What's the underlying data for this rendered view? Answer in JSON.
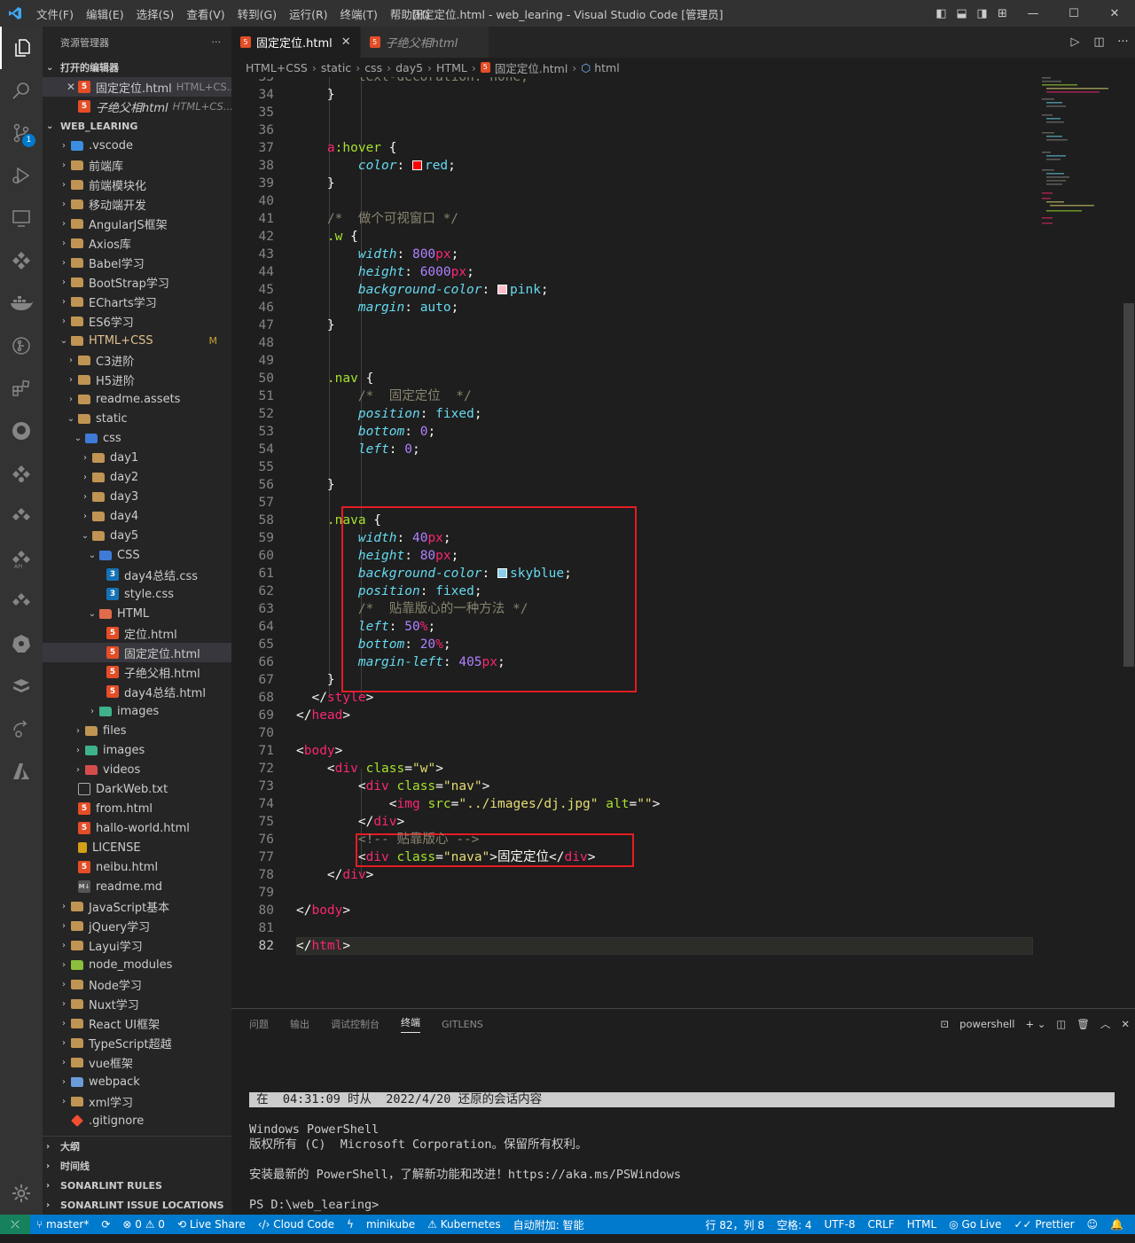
{
  "window": {
    "menu": [
      "文件(F)",
      "编辑(E)",
      "选择(S)",
      "查看(V)",
      "转到(G)",
      "运行(R)",
      "终端(T)",
      "帮助(H)"
    ],
    "title": "固定定位.html - web_learing - Visual Studio Code [管理员]"
  },
  "activity": {
    "scm_badge": "1"
  },
  "sidebar": {
    "title": "资源管理器",
    "more": "···",
    "open_editors_label": "打开的编辑器",
    "open_editors": [
      {
        "name": "固定定位.html",
        "desc": "HTML+CS..."
      },
      {
        "name": "子绝父相html",
        "desc": "HTML+CS..."
      }
    ],
    "workspace_label": "WEB_LEARING",
    "tree": [
      {
        "name": ".vscode",
        "depth": 1,
        "type": "folder-vscode",
        "tw": "›"
      },
      {
        "name": "前端库",
        "depth": 1,
        "type": "folder",
        "tw": "›"
      },
      {
        "name": "前端模块化",
        "depth": 1,
        "type": "folder",
        "tw": "›"
      },
      {
        "name": "移动端开发",
        "depth": 1,
        "type": "folder",
        "tw": "›"
      },
      {
        "name": "AngularJS框架",
        "depth": 1,
        "type": "folder",
        "tw": "›"
      },
      {
        "name": "Axios库",
        "depth": 1,
        "type": "folder",
        "tw": "›"
      },
      {
        "name": "Babel学习",
        "depth": 1,
        "type": "folder",
        "tw": "›"
      },
      {
        "name": "BootStrap学习",
        "depth": 1,
        "type": "folder",
        "tw": "›"
      },
      {
        "name": "ECharts学习",
        "depth": 1,
        "type": "folder",
        "tw": "›"
      },
      {
        "name": "ES6学习",
        "depth": 1,
        "type": "folder",
        "tw": "›"
      },
      {
        "name": "HTML+CSS",
        "depth": 1,
        "type": "folder",
        "tw": "⌄",
        "badge": "M",
        "modified": true
      },
      {
        "name": "C3进阶",
        "depth": 2,
        "type": "folder",
        "tw": "›"
      },
      {
        "name": "H5进阶",
        "depth": 2,
        "type": "folder",
        "tw": "›"
      },
      {
        "name": "readme.assets",
        "depth": 2,
        "type": "folder",
        "tw": "›"
      },
      {
        "name": "static",
        "depth": 2,
        "type": "folder",
        "tw": "⌄"
      },
      {
        "name": "css",
        "depth": 3,
        "type": "folder-css",
        "tw": "⌄"
      },
      {
        "name": "day1",
        "depth": 4,
        "type": "folder",
        "tw": "›"
      },
      {
        "name": "day2",
        "depth": 4,
        "type": "folder",
        "tw": "›"
      },
      {
        "name": "day3",
        "depth": 4,
        "type": "folder",
        "tw": "›"
      },
      {
        "name": "day4",
        "depth": 4,
        "type": "folder",
        "tw": "›"
      },
      {
        "name": "day5",
        "depth": 4,
        "type": "folder",
        "tw": "⌄"
      },
      {
        "name": "CSS",
        "depth": 5,
        "type": "folder-css",
        "tw": "⌄"
      },
      {
        "name": "day4总结.css",
        "depth": 6,
        "type": "css",
        "tw": ""
      },
      {
        "name": "style.css",
        "depth": 6,
        "type": "css",
        "tw": ""
      },
      {
        "name": "HTML",
        "depth": 5,
        "type": "folder-html",
        "tw": "⌄"
      },
      {
        "name": "定位.html",
        "depth": 6,
        "type": "html",
        "tw": ""
      },
      {
        "name": "固定定位.html",
        "depth": 6,
        "type": "html",
        "tw": "",
        "selected": true
      },
      {
        "name": "子绝父相.html",
        "depth": 6,
        "type": "html",
        "tw": ""
      },
      {
        "name": "day4总结.html",
        "depth": 6,
        "type": "html",
        "tw": ""
      },
      {
        "name": "images",
        "depth": 5,
        "type": "folder-img",
        "tw": "›"
      },
      {
        "name": "files",
        "depth": 3,
        "type": "folder",
        "tw": "›"
      },
      {
        "name": "images",
        "depth": 3,
        "type": "folder-img",
        "tw": "›"
      },
      {
        "name": "videos",
        "depth": 3,
        "type": "folder-vid",
        "tw": "›"
      },
      {
        "name": "DarkWeb.txt",
        "depth": 2,
        "type": "txt",
        "tw": ""
      },
      {
        "name": "from.html",
        "depth": 2,
        "type": "html",
        "tw": ""
      },
      {
        "name": "hallo-world.html",
        "depth": 2,
        "type": "html",
        "tw": ""
      },
      {
        "name": "LICENSE",
        "depth": 2,
        "type": "lic",
        "tw": ""
      },
      {
        "name": "neibu.html",
        "depth": 2,
        "type": "html",
        "tw": ""
      },
      {
        "name": "readme.md",
        "depth": 2,
        "type": "md",
        "tw": ""
      },
      {
        "name": "JavaScript基本",
        "depth": 1,
        "type": "folder",
        "tw": "›"
      },
      {
        "name": "jQuery学习",
        "depth": 1,
        "type": "folder",
        "tw": "›"
      },
      {
        "name": "Layui学习",
        "depth": 1,
        "type": "folder",
        "tw": "›"
      },
      {
        "name": "node_modules",
        "depth": 1,
        "type": "folder-node",
        "tw": "›"
      },
      {
        "name": "Node学习",
        "depth": 1,
        "type": "folder",
        "tw": "›"
      },
      {
        "name": "Nuxt学习",
        "depth": 1,
        "type": "folder",
        "tw": "›"
      },
      {
        "name": "React UI框架",
        "depth": 1,
        "type": "folder",
        "tw": "›"
      },
      {
        "name": "TypeScript超越",
        "depth": 1,
        "type": "folder",
        "tw": "›"
      },
      {
        "name": "vue框架",
        "depth": 1,
        "type": "folder",
        "tw": "›"
      },
      {
        "name": "webpack",
        "depth": 1,
        "type": "folder-webpack",
        "tw": "›"
      },
      {
        "name": "xml学习",
        "depth": 1,
        "type": "folder",
        "tw": "›"
      },
      {
        "name": ".gitignore",
        "depth": 1,
        "type": "git",
        "tw": ""
      }
    ],
    "bottom_sections": [
      "大纲",
      "时间线",
      "SONARLINT RULES",
      "SONARLINT ISSUE LOCATIONS"
    ]
  },
  "tabs": [
    {
      "label": "固定定位.html",
      "active": true,
      "close": "✕"
    },
    {
      "label": "子绝父相html",
      "active": false
    }
  ],
  "breadcrumb": [
    "HTML+CSS",
    "static",
    "css",
    "day5",
    "HTML",
    "固定定位.html",
    "html"
  ],
  "editor": {
    "first_line": 33,
    "current_line": 82,
    "lines": [
      [
        [
          "        ",
          "pu"
        ],
        [
          "text-decoration: none;",
          "cm"
        ]
      ],
      [
        [
          "    }",
          "pu"
        ]
      ],
      [],
      [],
      [
        [
          "    ",
          "pu"
        ],
        [
          "a",
          "tg"
        ],
        [
          ":hover",
          "at"
        ],
        [
          " {",
          "pu"
        ]
      ],
      [
        [
          "        ",
          "pu"
        ],
        [
          "color",
          "pr"
        ],
        [
          ": ",
          "pu"
        ],
        [
          "#SW:red",
          ""
        ],
        [
          "red",
          "kw"
        ],
        [
          ";",
          "pu"
        ]
      ],
      [
        [
          "    }",
          "pu"
        ]
      ],
      [],
      [
        [
          "    ",
          "pu"
        ],
        [
          "/*  做个可视窗口 */",
          "cm"
        ]
      ],
      [
        [
          "    ",
          "pu"
        ],
        [
          ".w",
          "at"
        ],
        [
          " {",
          "pu"
        ]
      ],
      [
        [
          "        ",
          "pu"
        ],
        [
          "width",
          "pr"
        ],
        [
          ": ",
          "pu"
        ],
        [
          "800",
          "nu"
        ],
        [
          "px",
          "tg"
        ],
        [
          ";",
          "pu"
        ]
      ],
      [
        [
          "        ",
          "pu"
        ],
        [
          "height",
          "pr"
        ],
        [
          ": ",
          "pu"
        ],
        [
          "6000",
          "nu"
        ],
        [
          "px",
          "tg"
        ],
        [
          ";",
          "pu"
        ]
      ],
      [
        [
          "        ",
          "pu"
        ],
        [
          "background-color",
          "pr"
        ],
        [
          ": ",
          "pu"
        ],
        [
          "#SW:pink",
          ""
        ],
        [
          "pink",
          "kw"
        ],
        [
          ";",
          "pu"
        ]
      ],
      [
        [
          "        ",
          "pu"
        ],
        [
          "margin",
          "pr"
        ],
        [
          ": ",
          "pu"
        ],
        [
          "auto",
          "kw"
        ],
        [
          ";",
          "pu"
        ]
      ],
      [
        [
          "    }",
          "pu"
        ]
      ],
      [],
      [],
      [
        [
          "    ",
          "pu"
        ],
        [
          ".nav",
          "at"
        ],
        [
          " {",
          "pu"
        ]
      ],
      [
        [
          "        ",
          "pu"
        ],
        [
          "/*  固定定位  */",
          "cm"
        ]
      ],
      [
        [
          "        ",
          "pu"
        ],
        [
          "position",
          "pr"
        ],
        [
          ": ",
          "pu"
        ],
        [
          "fixed",
          "kw"
        ],
        [
          ";",
          "pu"
        ]
      ],
      [
        [
          "        ",
          "pu"
        ],
        [
          "bottom",
          "pr"
        ],
        [
          ": ",
          "pu"
        ],
        [
          "0",
          "nu"
        ],
        [
          ";",
          "pu"
        ]
      ],
      [
        [
          "        ",
          "pu"
        ],
        [
          "left",
          "pr"
        ],
        [
          ": ",
          "pu"
        ],
        [
          "0",
          "nu"
        ],
        [
          ";",
          "pu"
        ]
      ],
      [],
      [
        [
          "    }",
          "pu"
        ]
      ],
      [],
      [
        [
          "    ",
          "pu"
        ],
        [
          ".nava",
          "at"
        ],
        [
          " {",
          "pu"
        ]
      ],
      [
        [
          "        ",
          "pu"
        ],
        [
          "width",
          "pr"
        ],
        [
          ": ",
          "pu"
        ],
        [
          "40",
          "nu"
        ],
        [
          "px",
          "tg"
        ],
        [
          ";",
          "pu"
        ]
      ],
      [
        [
          "        ",
          "pu"
        ],
        [
          "height",
          "pr"
        ],
        [
          ": ",
          "pu"
        ],
        [
          "80",
          "nu"
        ],
        [
          "px",
          "tg"
        ],
        [
          ";",
          "pu"
        ]
      ],
      [
        [
          "        ",
          "pu"
        ],
        [
          "background-color",
          "pr"
        ],
        [
          ": ",
          "pu"
        ],
        [
          "#SW:skyblue",
          ""
        ],
        [
          "skyblue",
          "kw"
        ],
        [
          ";",
          "pu"
        ]
      ],
      [
        [
          "        ",
          "pu"
        ],
        [
          "position",
          "pr"
        ],
        [
          ": ",
          "pu"
        ],
        [
          "fixed",
          "kw"
        ],
        [
          ";",
          "pu"
        ]
      ],
      [
        [
          "        ",
          "pu"
        ],
        [
          "/*  贴靠版心的一种方法 */",
          "cm"
        ]
      ],
      [
        [
          "        ",
          "pu"
        ],
        [
          "left",
          "pr"
        ],
        [
          ": ",
          "pu"
        ],
        [
          "50",
          "nu"
        ],
        [
          "%",
          "tg"
        ],
        [
          ";",
          "pu"
        ]
      ],
      [
        [
          "        ",
          "pu"
        ],
        [
          "bottom",
          "pr"
        ],
        [
          ": ",
          "pu"
        ],
        [
          "20",
          "nu"
        ],
        [
          "%",
          "tg"
        ],
        [
          ";",
          "pu"
        ]
      ],
      [
        [
          "        ",
          "pu"
        ],
        [
          "margin-left",
          "pr"
        ],
        [
          ": ",
          "pu"
        ],
        [
          "405",
          "nu"
        ],
        [
          "px",
          "tg"
        ],
        [
          ";",
          "pu"
        ]
      ],
      [
        [
          "    }",
          "pu"
        ]
      ],
      [
        [
          "  </",
          "pu"
        ],
        [
          "style",
          "tg"
        ],
        [
          ">",
          "pu"
        ]
      ],
      [
        [
          "</",
          "pu"
        ],
        [
          "head",
          "tg"
        ],
        [
          ">",
          "pu"
        ]
      ],
      [],
      [
        [
          "<",
          "pu"
        ],
        [
          "body",
          "tg"
        ],
        [
          ">",
          "pu"
        ]
      ],
      [
        [
          "    <",
          "pu"
        ],
        [
          "div",
          "tg"
        ],
        [
          " ",
          "pu"
        ],
        [
          "class",
          "at"
        ],
        [
          "=",
          "pu"
        ],
        [
          "\"w\"",
          "st"
        ],
        [
          ">",
          "pu"
        ]
      ],
      [
        [
          "        <",
          "pu"
        ],
        [
          "div",
          "tg"
        ],
        [
          " ",
          "pu"
        ],
        [
          "class",
          "at"
        ],
        [
          "=",
          "pu"
        ],
        [
          "\"nav\"",
          "st"
        ],
        [
          ">",
          "pu"
        ]
      ],
      [
        [
          "            <",
          "pu"
        ],
        [
          "img",
          "tg"
        ],
        [
          " ",
          "pu"
        ],
        [
          "src",
          "at"
        ],
        [
          "=",
          "pu"
        ],
        [
          "\"../images/dj.jpg\"",
          "st"
        ],
        [
          " ",
          "pu"
        ],
        [
          "alt",
          "at"
        ],
        [
          "=",
          "pu"
        ],
        [
          "\"\"",
          "st"
        ],
        [
          ">",
          "pu"
        ]
      ],
      [
        [
          "        </",
          "pu"
        ],
        [
          "div",
          "tg"
        ],
        [
          ">",
          "pu"
        ]
      ],
      [
        [
          "        ",
          "pu"
        ],
        [
          "<!-- 贴靠版心 -->",
          "cm"
        ]
      ],
      [
        [
          "        <",
          "pu"
        ],
        [
          "div",
          "tg"
        ],
        [
          " ",
          "pu"
        ],
        [
          "class",
          "at"
        ],
        [
          "=",
          "pu"
        ],
        [
          "\"nava\"",
          "st"
        ],
        [
          ">固定定位</",
          "pu"
        ],
        [
          "div",
          "tg"
        ],
        [
          ">",
          "pu"
        ]
      ],
      [
        [
          "    </",
          "pu"
        ],
        [
          "div",
          "tg"
        ],
        [
          ">",
          "pu"
        ]
      ],
      [],
      [
        [
          "</",
          "pu"
        ],
        [
          "body",
          "tg"
        ],
        [
          ">",
          "pu"
        ]
      ],
      [],
      [
        [
          "</",
          "pu"
        ],
        [
          "html",
          "tg"
        ],
        [
          ">",
          "pu"
        ]
      ]
    ]
  },
  "panel": {
    "tabs": [
      "问题",
      "输出",
      "调试控制台",
      "终端",
      "GITLENS"
    ],
    "active_tab": "终端",
    "shell": "powershell",
    "terminal_lines": [
      "Windows PowerShell",
      "版权所有 (C)  Microsoft Corporation。保留所有权利。",
      "",
      "安装最新的 PowerShell，了解新功能和改进！https://aka.ms/PSWindows",
      "",
      "PS D:\\web_learing>"
    ],
    "restored": " 在  04:31:09 时从  2022/4/20 还原的会话内容"
  },
  "statusbar": {
    "branch": "master*",
    "sync": "⟳",
    "problems": "⊗ 0 ⚠ 0",
    "live_share": "Live Share",
    "cloud_code": "Cloud Code",
    "minikube": "minikube",
    "kubernetes": "Kubernetes",
    "auto_attach": "自动附加: 智能",
    "position": "行 82，列 8",
    "spaces": "空格: 4",
    "encoding": "UTF-8",
    "eol": "CRLF",
    "language": "HTML",
    "go_live": "Go Live",
    "prettier": "Prettier"
  }
}
